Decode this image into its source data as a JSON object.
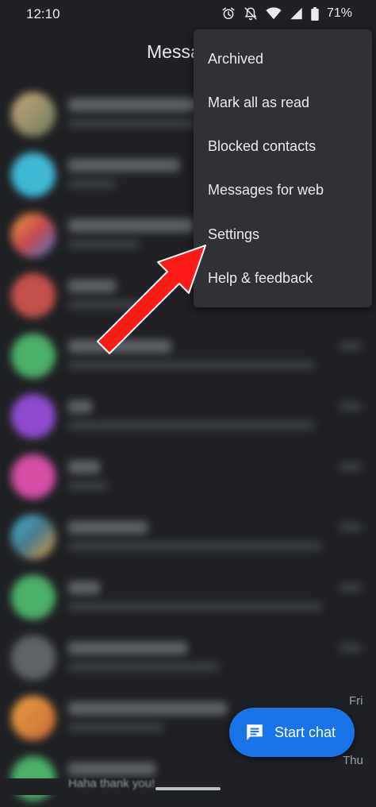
{
  "status_bar": {
    "time": "12:10",
    "battery_percent": "71%",
    "icons": [
      "alarm-icon",
      "bell-off-icon",
      "wifi-icon",
      "signal-icon",
      "battery-icon"
    ]
  },
  "app_bar": {
    "title": "Messa"
  },
  "overflow_menu": {
    "items": [
      {
        "label": "Archived"
      },
      {
        "label": "Mark all as read"
      },
      {
        "label": "Blocked contacts"
      },
      {
        "label": "Messages for web"
      },
      {
        "label": "Settings"
      },
      {
        "label": "Help & feedback"
      }
    ]
  },
  "conversation_list": {
    "day_labels": [
      "Fri",
      "Thu"
    ],
    "peek_text": "Haha thank you!"
  },
  "fab": {
    "label": "Start chat",
    "icon": "chat-icon"
  },
  "colors": {
    "background": "#202124",
    "menu": "#303134",
    "fab": "#1a73e8",
    "annotation_arrow": "#ff1a1a"
  }
}
